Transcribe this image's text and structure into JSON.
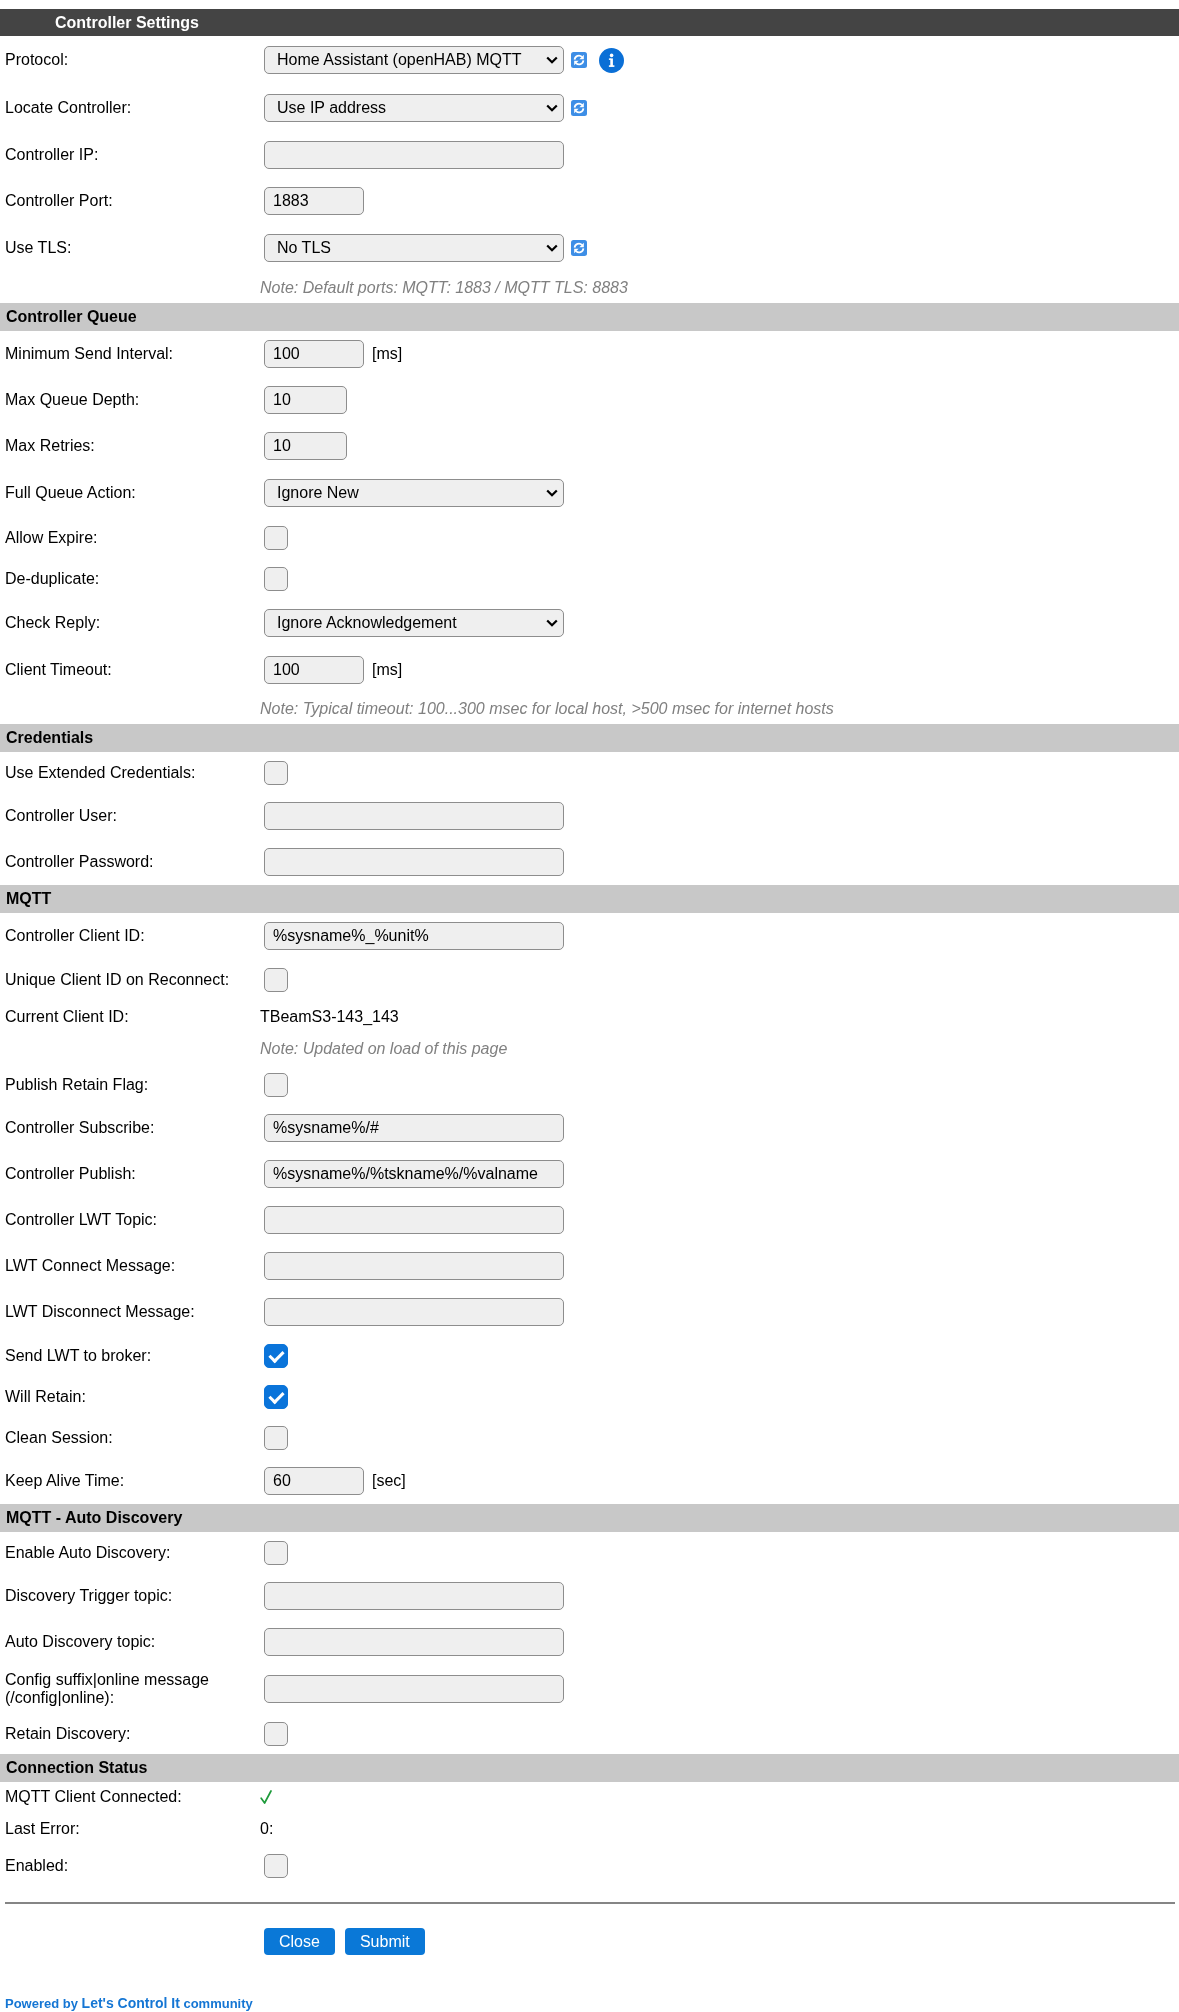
{
  "sections": [
    {
      "kind": "title",
      "title": "Controller Settings",
      "rows": [
        {
          "kind": "select",
          "label": "Protocol:",
          "value": "Home Assistant (openHAB) MQTT",
          "refresh": true,
          "help": true
        },
        {
          "kind": "select",
          "label": "Locate Controller:",
          "value": "Use IP address",
          "refresh": true,
          "help": false
        },
        {
          "kind": "field",
          "label": "Controller IP:"
        },
        {
          "kind": "number",
          "label": "Controller Port:",
          "value": "1883"
        },
        {
          "kind": "select",
          "label": "Use TLS:",
          "value": "No TLS",
          "refresh": true,
          "help": false
        },
        {
          "kind": "note",
          "text": "Note: Default ports: MQTT: 1883 / MQTT TLS: 8883"
        }
      ]
    },
    {
      "kind": "group",
      "title": "Controller Queue",
      "rows": [
        {
          "kind": "number",
          "label": "Minimum Send Interval:",
          "value": "100",
          "unit": "[ms]"
        },
        {
          "kind": "count",
          "label": "Max Queue Depth:",
          "value": "10"
        },
        {
          "kind": "count",
          "label": "Max Retries:",
          "value": "10"
        },
        {
          "kind": "select",
          "label": "Full Queue Action:",
          "value": "Ignore New",
          "refresh": false,
          "help": false
        },
        {
          "kind": "checkbox",
          "label": "Allow Expire:",
          "checked": false
        },
        {
          "kind": "checkbox",
          "label": "De-duplicate:",
          "checked": false
        },
        {
          "kind": "select",
          "label": "Check Reply:",
          "value": "Ignore Acknowledgement",
          "refresh": false,
          "help": false
        },
        {
          "kind": "number",
          "label": "Client Timeout:",
          "value": "100",
          "unit": "[ms]"
        },
        {
          "kind": "note",
          "text": "Note: Typical timeout: 100...300 msec for local host, >500 msec for internet hosts"
        }
      ]
    },
    {
      "kind": "group",
      "title": "Credentials",
      "rows": [
        {
          "kind": "checkbox",
          "label": "Use Extended Credentials:",
          "checked": false
        },
        {
          "kind": "field",
          "label": "Controller User:"
        },
        {
          "kind": "field",
          "label": "Controller Password:"
        }
      ]
    },
    {
      "kind": "group",
      "title": "MQTT",
      "rows": [
        {
          "kind": "field",
          "label": "Controller Client ID:",
          "value": "%sysname%_%unit%"
        },
        {
          "kind": "checkbox",
          "label": "Unique Client ID on Reconnect:",
          "checked": false
        },
        {
          "kind": "value",
          "label": "Current Client ID:",
          "value": "TBeamS3-143_143"
        },
        {
          "kind": "note",
          "text": "Note: Updated on load of this page"
        },
        {
          "kind": "checkbox",
          "label": "Publish Retain Flag:",
          "checked": false
        },
        {
          "kind": "field",
          "label": "Controller Subscribe:",
          "value": "%sysname%/#"
        },
        {
          "kind": "field",
          "label": "Controller Publish:",
          "value": "%sysname%/%tskname%/%valname"
        },
        {
          "kind": "field",
          "label": "Controller LWT Topic:"
        },
        {
          "kind": "field",
          "label": "LWT Connect Message:"
        },
        {
          "kind": "field",
          "label": "LWT Disconnect Message:"
        },
        {
          "kind": "checkbox",
          "label": "Send LWT to broker:",
          "checked": true
        },
        {
          "kind": "checkbox",
          "label": "Will Retain:",
          "checked": true
        },
        {
          "kind": "checkbox",
          "label": "Clean Session:",
          "checked": false
        },
        {
          "kind": "number",
          "label": "Keep Alive Time:",
          "value": "60",
          "unit": "[sec]"
        }
      ]
    },
    {
      "kind": "group",
      "title": "MQTT - Auto Discovery",
      "rows": [
        {
          "kind": "checkbox",
          "label": "Enable Auto Discovery:",
          "checked": false
        },
        {
          "kind": "field",
          "label": "Discovery Trigger topic:"
        },
        {
          "kind": "field",
          "label": "Auto Discovery topic:"
        },
        {
          "kind": "field",
          "label": "Config suffix|online message (/config|online):"
        },
        {
          "kind": "checkbox",
          "label": "Retain Discovery:",
          "checked": false
        }
      ]
    },
    {
      "kind": "group",
      "title": "Connection Status",
      "rows": [
        {
          "kind": "status",
          "label": "MQTT Client Connected:",
          "connected": true
        },
        {
          "kind": "value",
          "label": "Last Error:",
          "value": "0:"
        },
        {
          "kind": "checkbox",
          "label": "Enabled:",
          "checked": false
        }
      ]
    }
  ],
  "buttons": [
    {
      "label": "Close"
    },
    {
      "label": "Submit"
    }
  ],
  "footer": {
    "prefix": "Powered by",
    "link": "Let's Control It",
    "suffix": "community"
  }
}
